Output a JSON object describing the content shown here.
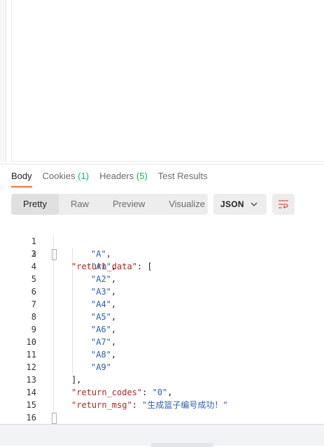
{
  "response_tabs": {
    "body": "Body",
    "cookies": "Cookies",
    "cookies_count": "(1)",
    "headers": "Headers",
    "headers_count": "(5)",
    "test_results": "Test Results"
  },
  "view_modes": {
    "pretty": "Pretty",
    "raw": "Raw",
    "preview": "Preview",
    "visualize": "Visualize"
  },
  "format_select": {
    "selected": "JSON"
  },
  "icons": {
    "chevron": "chevron-down-icon",
    "wrap": "wrap-lines-icon"
  },
  "colors": {
    "accent": "#ff6c37",
    "count": "#0cbb52",
    "key": "#b3241c",
    "string": "#2a5fb0"
  },
  "code": {
    "line_numbers": [
      "1",
      "2",
      "3",
      "4",
      "5",
      "6",
      "7",
      "8",
      "9",
      "10",
      "11",
      "12",
      "13",
      "14",
      "15",
      "16"
    ],
    "key_return_data": "\"return_data\"",
    "items": [
      "\"A\"",
      "\"A1\"",
      "\"A2\"",
      "\"A3\"",
      "\"A4\"",
      "\"A5\"",
      "\"A6\"",
      "\"A7\"",
      "\"A8\"",
      "\"A9\""
    ],
    "key_return_codes": "\"return_codes\"",
    "val_return_codes": "\"0\"",
    "key_return_msg": "\"return_msg\"",
    "val_return_msg": "\"生成篮子编号成功！\""
  }
}
